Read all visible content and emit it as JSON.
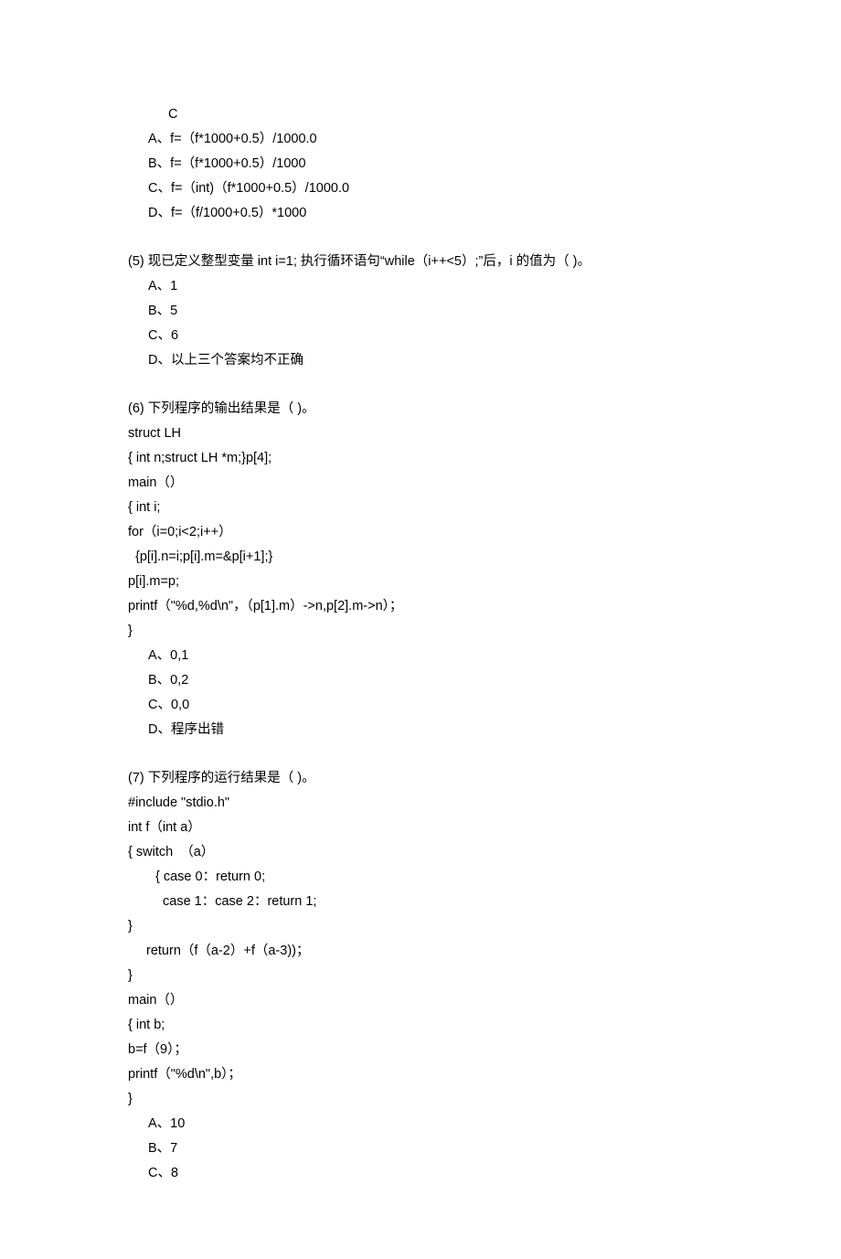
{
  "q4": {
    "prev_answer": "C",
    "options": {
      "a": "A、f=（f*1000+0.5）/1000.0",
      "b": "B、f=（f*1000+0.5）/1000",
      "c": "C、f=（int)（f*1000+0.5）/1000.0",
      "d": "D、f=（f/1000+0.5）*1000"
    }
  },
  "q5": {
    "head": "(5)   现已定义整型变量 int i=1;  执行循环语句“while（i++<5）;”后，i 的值为（  )。",
    "options": {
      "a": "A、1",
      "b": "B、5",
      "c": "C、6",
      "d": "D、以上三个答案均不正确"
    }
  },
  "q6": {
    "head": "(6)   下列程序的输出结果是（  )。",
    "code": {
      "l1": "struct LH",
      "l2": "{ int n;struct LH *m;}p[4];",
      "l3": "main（）",
      "l4": "{ int i;",
      "l5": "for（i=0;i<2;i++）",
      "l6": "{p[i].n=i;p[i].m=&p[i+1];}",
      "l7": "p[i].m=p;",
      "l8": "printf（\"%d,%d\\n\"，（p[1].m）->n,p[2].m->n）；",
      "l9": "}"
    },
    "options": {
      "a": "A、0,1",
      "b": "B、0,2",
      "c": "C、0,0",
      "d": "D、程序出错"
    }
  },
  "q7": {
    "head": "(7)   下列程序的运行结果是（  )。",
    "code": {
      "l1": "#include \"stdio.h\"",
      "l2": "int f（int a）",
      "l3": "{ switch  （a）",
      "l4": "{ case 0：return 0;",
      "l5": "case 1：case 2：return 1;",
      "l6": "}",
      "l7": "return（f（a-2）+f（a-3))；",
      "l8": "}",
      "l9": "main（）",
      "l10": "{ int b;",
      "l11": "b=f（9）；",
      "l12": "printf（\"%d\\n\",b）；",
      "l13": "}"
    },
    "options": {
      "a": "A、10",
      "b": "B、7",
      "c": "C、8"
    }
  }
}
